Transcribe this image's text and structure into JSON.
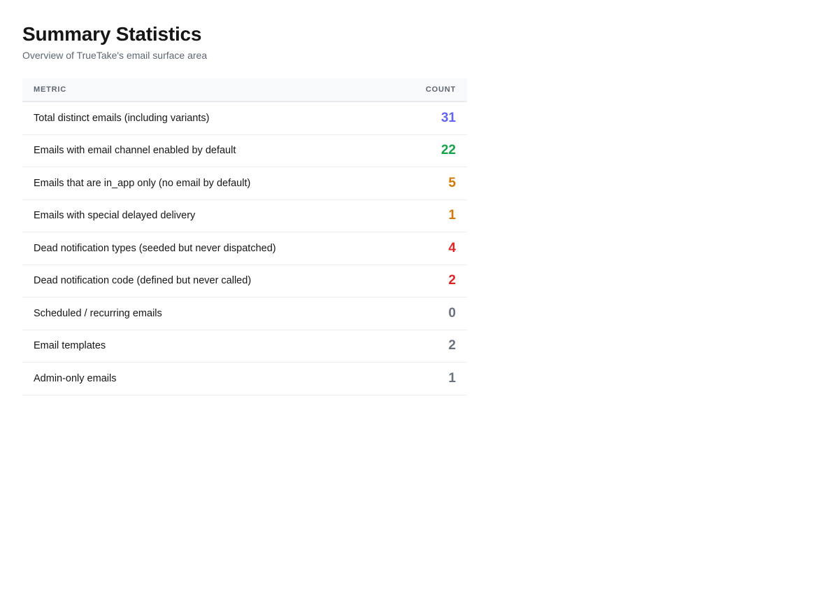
{
  "header": {
    "title": "Summary Statistics",
    "subtitle": "Overview of TrueTake's email surface area"
  },
  "table": {
    "columns": [
      "METRIC",
      "COUNT"
    ],
    "rows": [
      {
        "metric": "Total distinct emails (including variants)",
        "count": "31",
        "color": "#6366f1"
      },
      {
        "metric": "Emails with email channel enabled by default",
        "count": "22",
        "color": "#16a34a"
      },
      {
        "metric": "Emails that are in_app only (no email by default)",
        "count": "5",
        "color": "#d97706"
      },
      {
        "metric": "Emails with special delayed delivery",
        "count": "1",
        "color": "#d97706"
      },
      {
        "metric": "Dead notification types (seeded but never dispatched)",
        "count": "4",
        "color": "#dc2626"
      },
      {
        "metric": "Dead notification code (defined but never called)",
        "count": "2",
        "color": "#dc2626"
      },
      {
        "metric": "Scheduled / recurring emails",
        "count": "0",
        "color": "#6b7280"
      },
      {
        "metric": "Email templates",
        "count": "2",
        "color": "#6b7280"
      },
      {
        "metric": "Admin-only emails",
        "count": "1",
        "color": "#6b7280"
      }
    ]
  }
}
